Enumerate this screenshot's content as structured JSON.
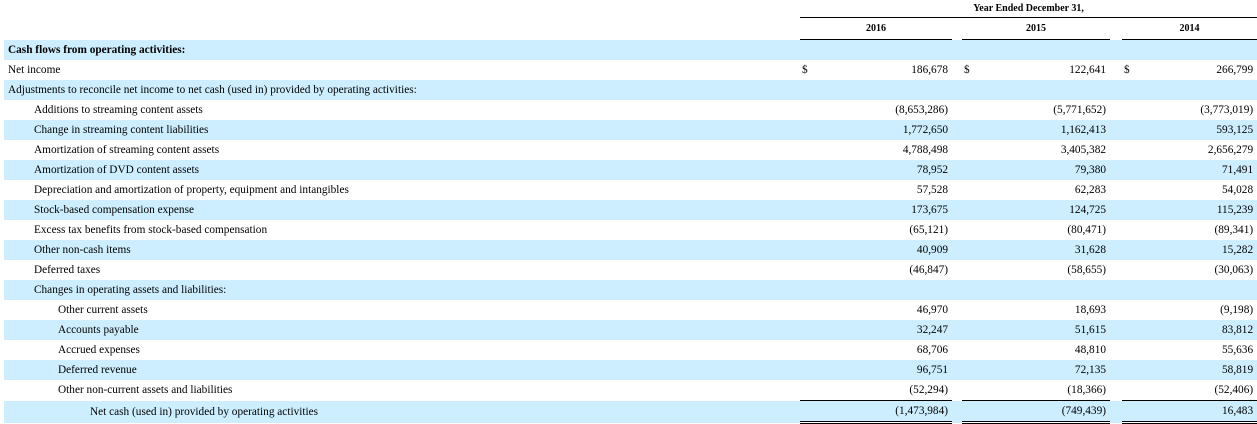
{
  "header": {
    "period_title": "Year Ended December 31,",
    "years": [
      "2016",
      "2015",
      "2014"
    ]
  },
  "section_title": "Cash flows from operating activities:",
  "rows": [
    {
      "label": "Net income",
      "indent": 0,
      "values": [
        "186,678",
        "122,641",
        "266,799"
      ],
      "currency": "$"
    },
    {
      "label": "Adjustments to reconcile net income to net cash (used in) provided by operating activities:",
      "indent": 0,
      "values": [
        "",
        "",
        ""
      ]
    },
    {
      "label": "Additions to streaming content assets",
      "indent": 1,
      "values": [
        "(8,653,286)",
        "(5,771,652)",
        "(3,773,019)"
      ]
    },
    {
      "label": "Change in streaming content liabilities",
      "indent": 1,
      "values": [
        "1,772,650",
        "1,162,413",
        "593,125"
      ]
    },
    {
      "label": "Amortization of streaming content assets",
      "indent": 1,
      "values": [
        "4,788,498",
        "3,405,382",
        "2,656,279"
      ]
    },
    {
      "label": "Amortization of DVD content assets",
      "indent": 1,
      "values": [
        "78,952",
        "79,380",
        "71,491"
      ]
    },
    {
      "label": "Depreciation and amortization of property, equipment and intangibles",
      "indent": 1,
      "values": [
        "57,528",
        "62,283",
        "54,028"
      ]
    },
    {
      "label": "Stock-based compensation expense",
      "indent": 1,
      "values": [
        "173,675",
        "124,725",
        "115,239"
      ]
    },
    {
      "label": "Excess tax benefits from stock-based compensation",
      "indent": 1,
      "values": [
        "(65,121)",
        "(80,471)",
        "(89,341)"
      ]
    },
    {
      "label": "Other non-cash items",
      "indent": 1,
      "values": [
        "40,909",
        "31,628",
        "15,282"
      ]
    },
    {
      "label": "Deferred taxes",
      "indent": 1,
      "values": [
        "(46,847)",
        "(58,655)",
        "(30,063)"
      ]
    },
    {
      "label": "Changes in operating assets and liabilities:",
      "indent": 1,
      "values": [
        "",
        "",
        ""
      ]
    },
    {
      "label": "Other current assets",
      "indent": 2,
      "values": [
        "46,970",
        "18,693",
        "(9,198)"
      ]
    },
    {
      "label": "Accounts payable",
      "indent": 2,
      "values": [
        "32,247",
        "51,615",
        "83,812"
      ]
    },
    {
      "label": "Accrued expenses",
      "indent": 2,
      "values": [
        "68,706",
        "48,810",
        "55,636"
      ]
    },
    {
      "label": "Deferred revenue",
      "indent": 2,
      "values": [
        "96,751",
        "72,135",
        "58,819"
      ]
    },
    {
      "label": "Other non-current assets and liabilities",
      "indent": 2,
      "values": [
        "(52,294)",
        "(18,366)",
        "(52,406)"
      ]
    },
    {
      "label": "Net cash (used in) provided by operating activities",
      "indent": 3,
      "values": [
        "(1,473,984)",
        "(749,439)",
        "16,483"
      ],
      "total": true
    }
  ]
}
